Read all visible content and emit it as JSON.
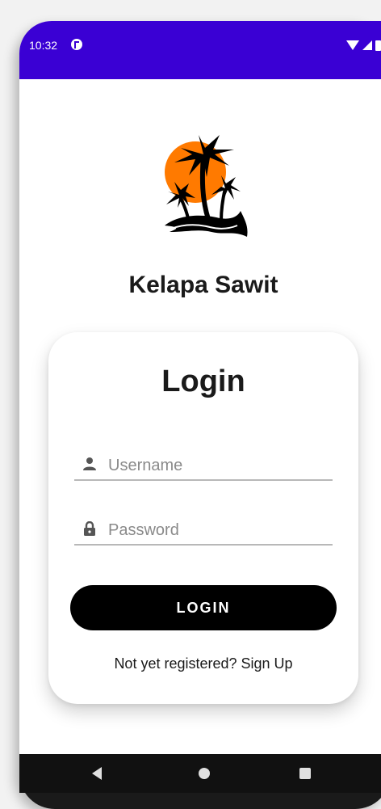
{
  "status_bar": {
    "time": "10:32",
    "background": "#3a00d4",
    "icons": [
      "app-notification-icon",
      "wifi-icon",
      "signal-icon",
      "battery-icon"
    ]
  },
  "app": {
    "title": "Kelapa Sawit",
    "logo": "palm-tree-sunset-logo",
    "logo_sun_color": "#ff7a00"
  },
  "login_card": {
    "title": "Login",
    "username": {
      "placeholder": "Username",
      "value": "",
      "icon": "person-icon"
    },
    "password": {
      "placeholder": "Password",
      "value": "",
      "icon": "lock-icon"
    },
    "login_button_label": "LOGIN",
    "signup_text": "Not yet registered? Sign Up"
  },
  "nav_bar": {
    "buttons": [
      "back-icon",
      "home-icon",
      "recents-icon"
    ]
  }
}
